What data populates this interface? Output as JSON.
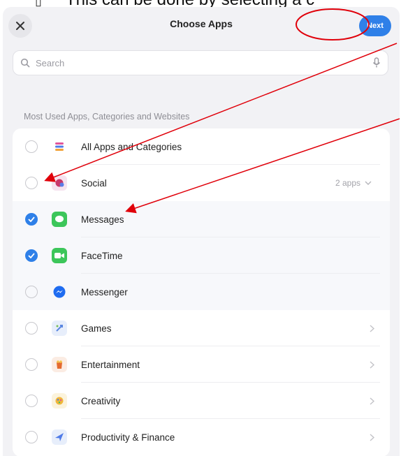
{
  "top_text": "This can be done by selecting a c",
  "header": {
    "title": "Choose Apps",
    "next_label": "Next"
  },
  "search": {
    "placeholder": "Search"
  },
  "section_title": "Most Used Apps, Categories and Websites",
  "rows": [
    {
      "label": "All Apps and Categories",
      "checked": false,
      "icon": "stack-icon"
    },
    {
      "label": "Social",
      "checked": false,
      "icon": "social-icon",
      "meta": "2 apps"
    },
    {
      "label": "Messages",
      "checked": true,
      "icon": "messages-icon"
    },
    {
      "label": "FaceTime",
      "checked": true,
      "icon": "facetime-icon"
    },
    {
      "label": "Messenger",
      "checked": false,
      "icon": "messenger-icon"
    },
    {
      "label": "Games",
      "checked": false,
      "icon": "games-icon"
    },
    {
      "label": "Entertainment",
      "checked": false,
      "icon": "entertainment-icon"
    },
    {
      "label": "Creativity",
      "checked": false,
      "icon": "creativity-icon"
    },
    {
      "label": "Productivity & Finance",
      "checked": false,
      "icon": "productivity-icon"
    }
  ],
  "colors": {
    "accent": "#2f80e8",
    "annotation": "#e0000a"
  }
}
